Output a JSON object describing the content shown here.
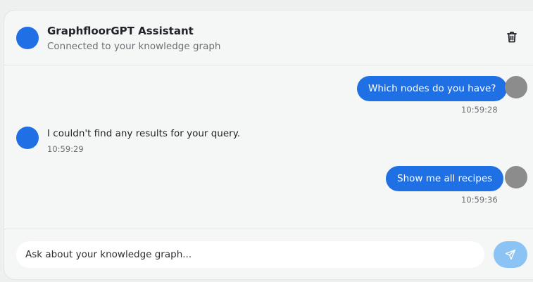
{
  "header": {
    "title": "GraphfloorGPT Assistant",
    "subtitle": "Connected to your knowledge graph",
    "delete_icon": "trash-icon"
  },
  "messages": [
    {
      "role": "user",
      "text": "Which nodes do you have?",
      "time": "10:59:28"
    },
    {
      "role": "assistant",
      "text": "I couldn't find any results for your query.",
      "time": "10:59:29"
    },
    {
      "role": "user",
      "text": "Show me all recipes",
      "time": "10:59:36"
    }
  ],
  "composer": {
    "placeholder": "Ask about your knowledge graph...",
    "send_icon": "send-icon"
  },
  "colors": {
    "accent": "#1f6fe5",
    "send_button": "#8cc3f5",
    "user_avatar": "#8c8c8c"
  }
}
